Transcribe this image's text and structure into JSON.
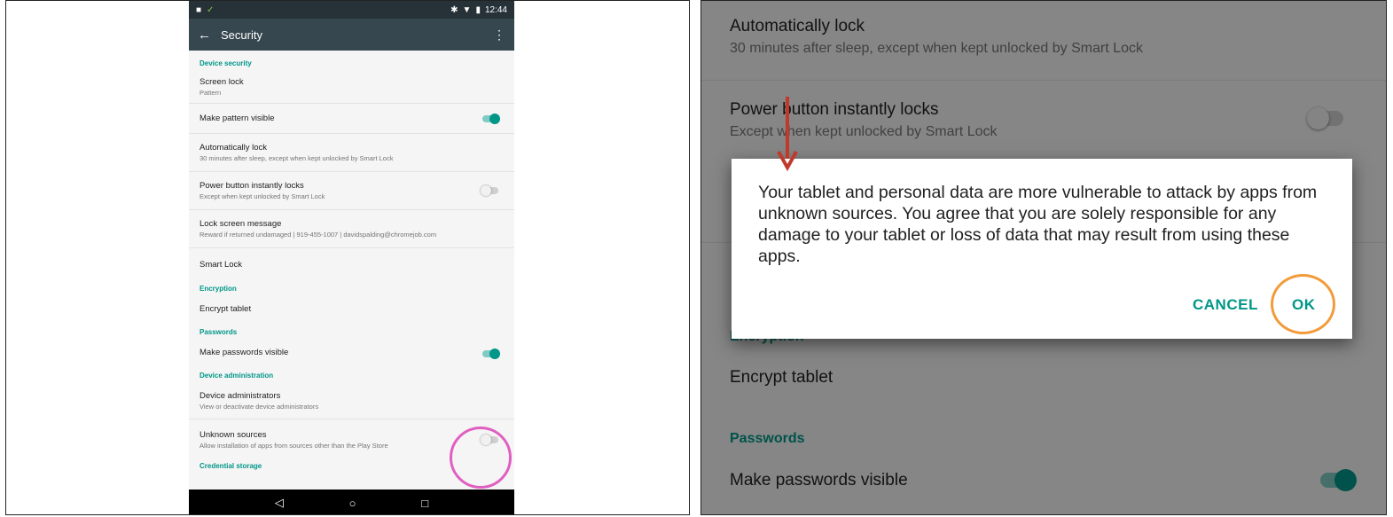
{
  "left": {
    "status_bar": {
      "time": "12:44"
    },
    "app_bar": {
      "title": "Security"
    },
    "sections": {
      "device_security": "Device security",
      "encryption": "Encryption",
      "passwords": "Passwords",
      "device_admin": "Device administration",
      "credential_storage": "Credential storage"
    },
    "rows": {
      "screen_lock": {
        "title": "Screen lock",
        "subtitle": "Pattern"
      },
      "pattern_visible": {
        "title": "Make pattern visible",
        "toggle": "on"
      },
      "auto_lock": {
        "title": "Automatically lock",
        "subtitle": "30 minutes after sleep, except when kept unlocked by Smart Lock"
      },
      "power_button": {
        "title": "Power button instantly locks",
        "subtitle": "Except when kept unlocked by Smart Lock",
        "toggle": "off"
      },
      "lock_message": {
        "title": "Lock screen message",
        "subtitle": "Reward if returned undamaged | 919-455-1007 | davidspalding@chromejob.com"
      },
      "smart_lock": {
        "title": "Smart Lock"
      },
      "encrypt": {
        "title": "Encrypt tablet"
      },
      "passwords_visible": {
        "title": "Make passwords visible",
        "toggle": "on"
      },
      "device_admins": {
        "title": "Device administrators",
        "subtitle": "View or deactivate device administrators"
      },
      "unknown_sources": {
        "title": "Unknown sources",
        "subtitle": "Allow installation of apps from sources other than the Play Store",
        "toggle": "off"
      }
    },
    "nav_icons": [
      "back-triangle-icon",
      "home-circle-icon",
      "recents-square-icon"
    ]
  },
  "right": {
    "auto_lock": {
      "title": "Automatically lock",
      "subtitle": "30 minutes after sleep, except when kept unlocked by Smart Lock"
    },
    "power_button": {
      "title": "Power button instantly locks",
      "subtitle": "Except when kept unlocked by Smart Lock",
      "toggle": "off"
    },
    "encryption_header": "Encryption",
    "encrypt": "Encrypt tablet",
    "passwords_header": "Passwords",
    "passwords_visible": {
      "title": "Make passwords visible",
      "toggle": "on"
    },
    "dialog": {
      "message": "Your tablet and personal data are more vulnerable to attack by apps from unknown sources. You agree that you are solely responsible for any damage to your tablet or loss of data that may result from using these apps.",
      "cancel": "CANCEL",
      "ok": "OK"
    }
  },
  "colors": {
    "accent": "#009688",
    "app_bar": "#37474f",
    "status_bar": "#263238",
    "callout_pink": "#e05fc0",
    "callout_orange": "#f29b3b",
    "arrow": "#c0392b"
  }
}
